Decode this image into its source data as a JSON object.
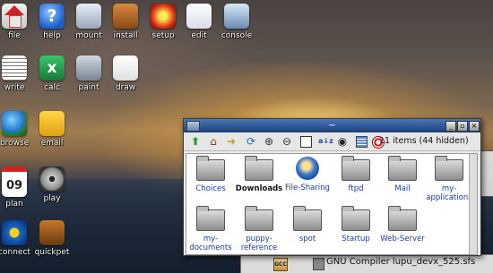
{
  "desktop": {
    "icons": [
      {
        "label": "file",
        "icon": "home-icon"
      },
      {
        "label": "help",
        "icon": "help-icon"
      },
      {
        "label": "mount",
        "icon": "drive-icon"
      },
      {
        "label": "install",
        "icon": "briefcase-icon"
      },
      {
        "label": "setup",
        "icon": "setup-icon"
      },
      {
        "label": "edit",
        "icon": "notepad-icon"
      },
      {
        "label": "console",
        "icon": "monitor-icon"
      },
      {
        "label": "write",
        "icon": "document-icon"
      },
      {
        "label": "calc",
        "icon": "spreadsheet-icon"
      },
      {
        "label": "paint",
        "icon": "paint-icon"
      },
      {
        "label": "draw",
        "icon": "pencil-icon"
      },
      {
        "label": "browse",
        "icon": "globe-icon"
      },
      {
        "label": "email",
        "icon": "envelope-icon"
      },
      {
        "label": "plan",
        "icon": "calendar-icon",
        "day": "09"
      },
      {
        "label": "play",
        "icon": "film-reel-icon"
      },
      {
        "label": "connect",
        "icon": "connect-icon"
      },
      {
        "label": "quickpet",
        "icon": "toolbox-icon"
      }
    ]
  },
  "filemanager": {
    "title": "~",
    "titlebar_buttons": {
      "minimize": "_",
      "maximize": "▫",
      "close": "×"
    },
    "toolbar": {
      "items_count": "11 items (44 hidden)",
      "buttons": [
        "up-icon",
        "home-icon",
        "back-icon",
        "refresh-icon",
        "zoom-in-icon",
        "zoom-out-icon",
        "select-icon",
        "sort-az-icon",
        "show-hidden-icon",
        "details-icon",
        "help-lifebuoy-icon"
      ]
    },
    "files": [
      {
        "name": "Choices",
        "type": "folder",
        "bold": false
      },
      {
        "name": "Downloads",
        "type": "folder",
        "bold": true
      },
      {
        "name": "File-Sharing",
        "type": "special",
        "bold": false
      },
      {
        "name": "ftpd",
        "type": "folder",
        "bold": false
      },
      {
        "name": "Mail",
        "type": "folder",
        "bold": false
      },
      {
        "name": "my-applications",
        "type": "folder",
        "bold": false
      },
      {
        "name": "my-documents",
        "type": "folder",
        "bold": false
      },
      {
        "name": "puppy-reference",
        "type": "folder",
        "bold": false
      },
      {
        "name": "spot",
        "type": "folder",
        "bold": false
      },
      {
        "name": "Startup",
        "type": "folder",
        "bold": false
      },
      {
        "name": "Web-Server",
        "type": "folder",
        "bold": false
      }
    ]
  },
  "background_window": {
    "badge": "GCC",
    "text": "GNU Compiler lupu_devx_525.sfs"
  },
  "colors": {
    "titlebar": "#2a56a0",
    "folder_label": "#1a3aa8"
  }
}
